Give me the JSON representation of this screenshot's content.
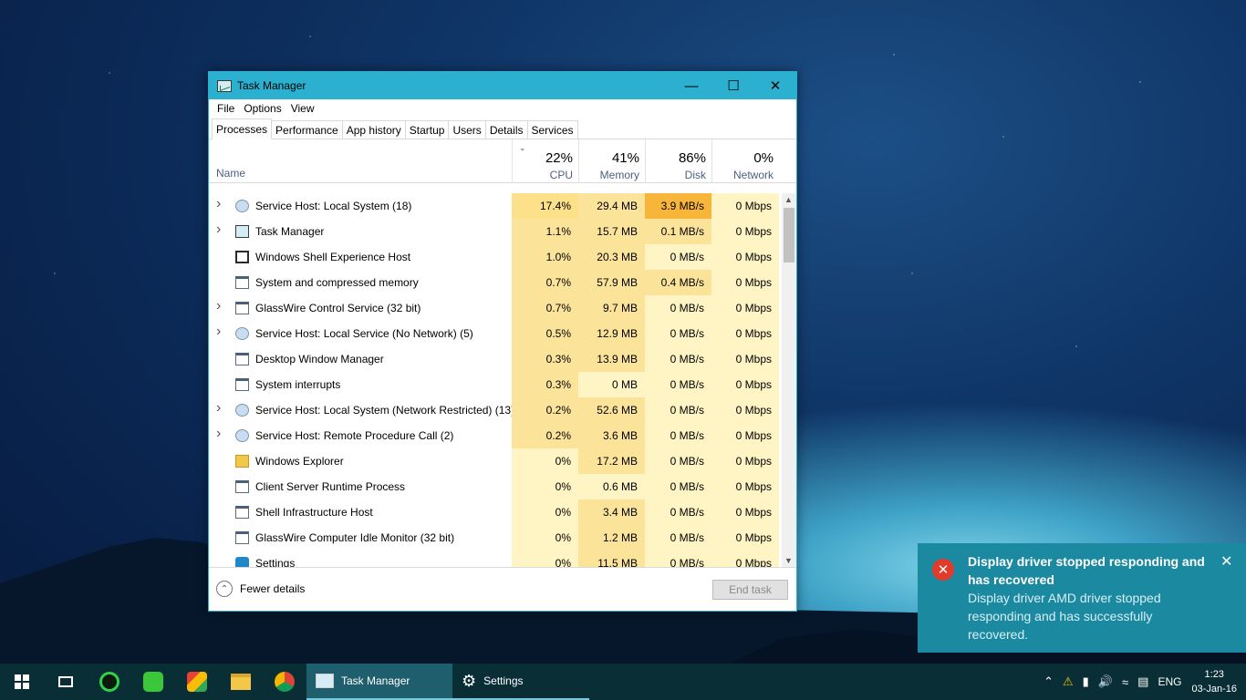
{
  "window": {
    "title": "Task Manager",
    "controls": {
      "minimize": "—",
      "maximize": "☐",
      "close": "✕"
    }
  },
  "menu": [
    "File",
    "Options",
    "View"
  ],
  "tabs": [
    "Processes",
    "Performance",
    "App history",
    "Startup",
    "Users",
    "Details",
    "Services"
  ],
  "columns": {
    "name": "Name",
    "cpu": {
      "pct": "22%",
      "label": "CPU"
    },
    "memory": {
      "pct": "41%",
      "label": "Memory"
    },
    "disk": {
      "pct": "86%",
      "label": "Disk"
    },
    "network": {
      "pct": "0%",
      "label": "Network"
    }
  },
  "processes": [
    {
      "name": "Service Host: Local System (18)",
      "expand": true,
      "icon": "gear-icon",
      "cpu": "17.4%",
      "mem": "29.4 MB",
      "disk": "3.9 MB/s",
      "net": "0 Mbps"
    },
    {
      "name": "Task Manager",
      "expand": true,
      "icon": "taskmanager-icon",
      "cpu": "1.1%",
      "mem": "15.7 MB",
      "disk": "0.1 MB/s",
      "net": "0 Mbps"
    },
    {
      "name": "Windows Shell Experience Host",
      "expand": false,
      "icon": "shell-icon",
      "cpu": "1.0%",
      "mem": "20.3 MB",
      "disk": "0 MB/s",
      "net": "0 Mbps"
    },
    {
      "name": "System and compressed memory",
      "expand": false,
      "icon": "window-icon",
      "cpu": "0.7%",
      "mem": "57.9 MB",
      "disk": "0.4 MB/s",
      "net": "0 Mbps"
    },
    {
      "name": "GlassWire Control Service (32 bit)",
      "expand": true,
      "icon": "window-icon",
      "cpu": "0.7%",
      "mem": "9.7 MB",
      "disk": "0 MB/s",
      "net": "0 Mbps"
    },
    {
      "name": "Service Host: Local Service (No Network) (5)",
      "expand": true,
      "icon": "gear-icon",
      "cpu": "0.5%",
      "mem": "12.9 MB",
      "disk": "0 MB/s",
      "net": "0 Mbps"
    },
    {
      "name": "Desktop Window Manager",
      "expand": false,
      "icon": "window-icon",
      "cpu": "0.3%",
      "mem": "13.9 MB",
      "disk": "0 MB/s",
      "net": "0 Mbps"
    },
    {
      "name": "System interrupts",
      "expand": false,
      "icon": "window-icon",
      "cpu": "0.3%",
      "mem": "0 MB",
      "disk": "0 MB/s",
      "net": "0 Mbps"
    },
    {
      "name": "Service Host: Local System (Network Restricted) (13)",
      "expand": true,
      "icon": "gear-icon",
      "cpu": "0.2%",
      "mem": "52.6 MB",
      "disk": "0 MB/s",
      "net": "0 Mbps"
    },
    {
      "name": "Service Host: Remote Procedure Call (2)",
      "expand": true,
      "icon": "gear-icon",
      "cpu": "0.2%",
      "mem": "3.6 MB",
      "disk": "0 MB/s",
      "net": "0 Mbps"
    },
    {
      "name": "Windows Explorer",
      "expand": false,
      "icon": "folder-icon",
      "cpu": "0%",
      "mem": "17.2 MB",
      "disk": "0 MB/s",
      "net": "0 Mbps"
    },
    {
      "name": "Client Server Runtime Process",
      "expand": false,
      "icon": "window-icon",
      "cpu": "0%",
      "mem": "0.6 MB",
      "disk": "0 MB/s",
      "net": "0 Mbps"
    },
    {
      "name": "Shell Infrastructure Host",
      "expand": false,
      "icon": "window-icon",
      "cpu": "0%",
      "mem": "3.4 MB",
      "disk": "0 MB/s",
      "net": "0 Mbps"
    },
    {
      "name": "GlassWire Computer Idle Monitor (32 bit)",
      "expand": false,
      "icon": "window-icon",
      "cpu": "0%",
      "mem": "1.2 MB",
      "disk": "0 MB/s",
      "net": "0 Mbps"
    },
    {
      "name": "Settings",
      "expand": false,
      "icon": "settings-icon",
      "cpu": "0%",
      "mem": "11.5 MB",
      "disk": "0 MB/s",
      "net": "0 Mbps"
    }
  ],
  "footer": {
    "fewer_details": "Fewer details",
    "end_task": "End task"
  },
  "toast": {
    "title": "Display driver stopped responding and has recovered",
    "message": "Display driver AMD driver stopped responding and has successfully recovered.",
    "close": "✕"
  },
  "taskbar": {
    "apps": [
      {
        "label": "Task Manager",
        "state": "active"
      },
      {
        "label": "Settings",
        "state": "open"
      }
    ],
    "language": "ENG",
    "time": "1:23",
    "date": "03-Jan-16"
  },
  "colors": {
    "titlebar": "#2bb0cf",
    "toast": "#1b8aa1",
    "taskbar": "#0a2e36",
    "heat_high": "#f7b53a",
    "heat_mid": "#fbe39a",
    "heat_low": "#fff4c4"
  }
}
